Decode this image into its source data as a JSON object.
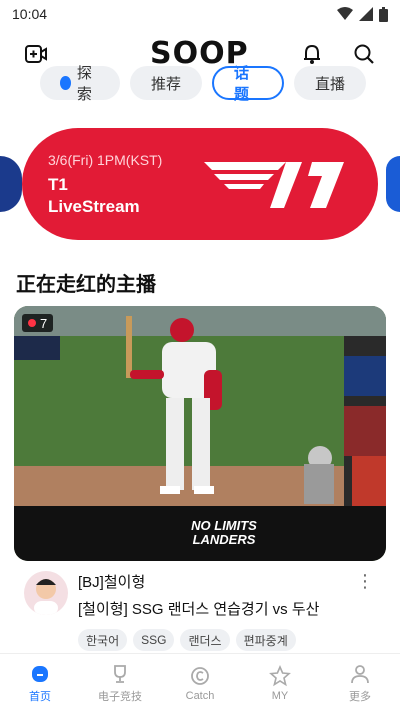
{
  "status": {
    "time": "10:04"
  },
  "header": {
    "logo": "SOOP"
  },
  "tabs": [
    {
      "label": "探索"
    },
    {
      "label": "推荐"
    },
    {
      "label": "话题"
    },
    {
      "label": "直播"
    }
  ],
  "banner": {
    "date": "3/6(Fri) 1PM(KST)",
    "title": "T1",
    "subtitle": "LiveStream",
    "logo_text": "T1"
  },
  "section": {
    "title": "正在走红的主播"
  },
  "video": {
    "viewers": "7",
    "overlay": "NO LIMITS LANDERS",
    "streamer": "[BJ]철이형",
    "title": "[철이형] SSG 랜더스 연습경기 vs 두산",
    "tags": [
      "한국어",
      "SSG",
      "랜더스",
      "편파중계"
    ]
  },
  "nav": [
    {
      "label": "首页",
      "icon": "home-icon"
    },
    {
      "label": "电子竞技",
      "icon": "trophy-icon"
    },
    {
      "label": "Catch",
      "icon": "catch-icon"
    },
    {
      "label": "MY",
      "icon": "star-icon"
    },
    {
      "label": "更多",
      "icon": "person-icon"
    }
  ],
  "colors": {
    "accent": "#1a76ff",
    "banner": "#e21b36"
  }
}
